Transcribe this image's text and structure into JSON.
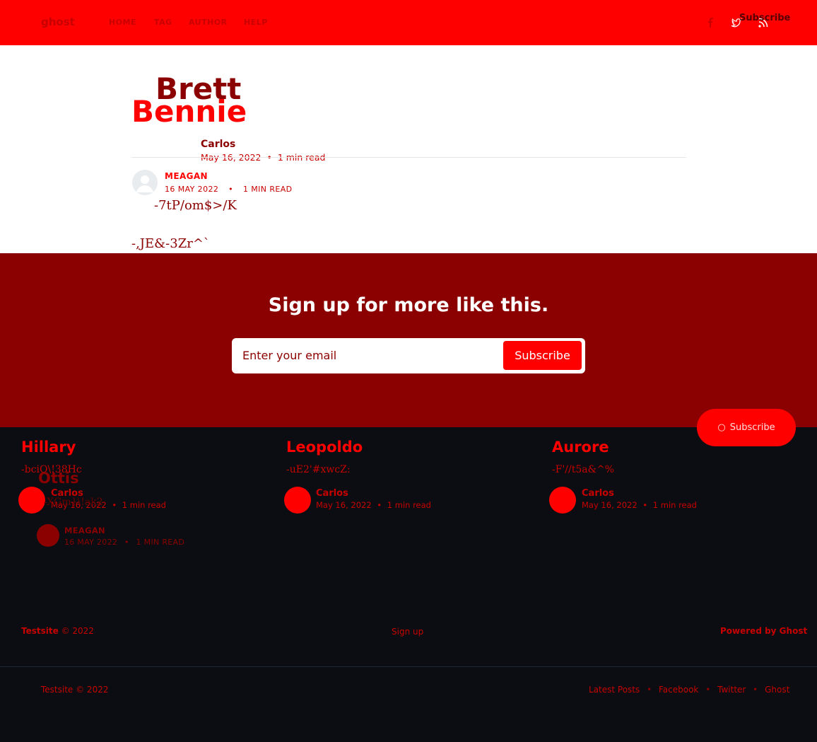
{
  "header": {
    "logo": "ghost",
    "nav": [
      "HOME",
      "TAG",
      "AUTHOR",
      "HELP"
    ],
    "subscribe": "Subscribe",
    "icons": [
      "facebook-icon",
      "twitter-icon",
      "rss-icon"
    ]
  },
  "article": {
    "title_line1": "Brett",
    "title_line2": "Bennie",
    "author1": {
      "name": "Carlos",
      "date": "May 16, 2022",
      "read": "1 min read"
    },
    "author2": {
      "name": "MEAGAN",
      "date": "16 MAY 2022",
      "read": "1 MIN READ"
    },
    "text1": "-7tP/om$>/K",
    "text2": "-,JE&-3Zr^`"
  },
  "signup": {
    "title": "Sign up for more like this.",
    "placeholder": "Enter your email",
    "button": "Subscribe"
  },
  "related": [
    {
      "title": "Hillary",
      "excerpt": "-bciQ\\!38Hc",
      "author": "Carlos",
      "date": "May 16, 2022",
      "read": "1 min read"
    },
    {
      "title": "Leopoldo",
      "excerpt": "-uE2'#xwcZ:",
      "author": "Carlos",
      "date": "May 16, 2022",
      "read": "1 min read"
    },
    {
      "title": "Aurore",
      "excerpt": "-F'//t5a&^%",
      "author": "Carlos",
      "date": "May 16, 2022",
      "read": "1 min read"
    }
  ],
  "overlap": {
    "title": "Ottis",
    "excerpt": "-XGm}\\!ak2",
    "author": "MEAGAN",
    "date": "16 MAY 2022",
    "read": "1 MIN READ"
  },
  "floating_subscribe": "Subscribe",
  "footer_mid": {
    "site": "Testsite",
    "copyright": "© 2022",
    "signup": "Sign up",
    "powered": "Powered by Ghost"
  },
  "footer_bottom": {
    "copy": "Testsite © 2022",
    "links": [
      "Latest Posts",
      "Facebook",
      "Twitter",
      "Ghost"
    ]
  },
  "separator": "•"
}
